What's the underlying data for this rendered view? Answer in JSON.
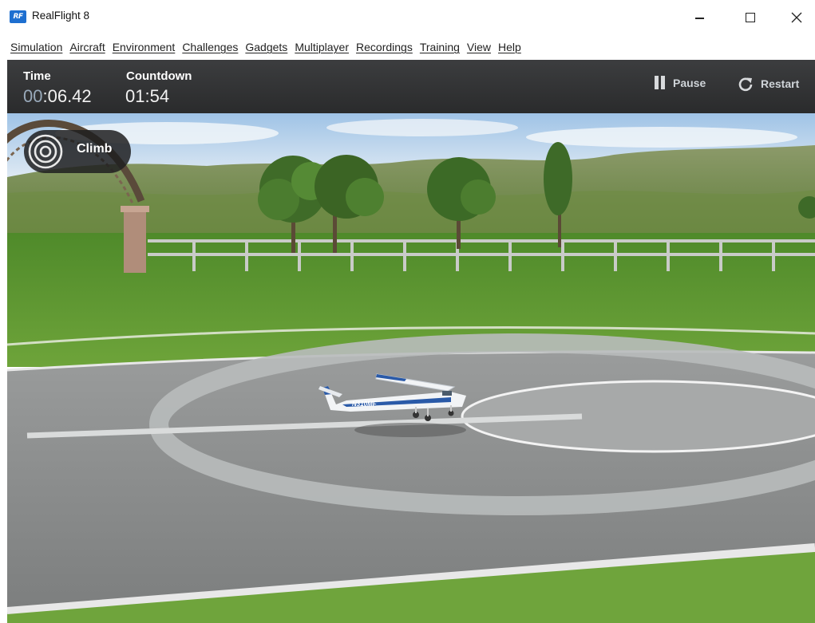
{
  "window": {
    "title": "RealFlight 8",
    "icon_text": "RF"
  },
  "menu": [
    {
      "label": "Simulation"
    },
    {
      "label": "Aircraft"
    },
    {
      "label": "Environment"
    },
    {
      "label": "Challenges"
    },
    {
      "label": "Gadgets"
    },
    {
      "label": "Multiplayer"
    },
    {
      "label": "Recordings"
    },
    {
      "label": "Training"
    },
    {
      "label": "View"
    },
    {
      "label": "Help"
    }
  ],
  "hud": {
    "time_label": "Time",
    "time_prefix": "00",
    "time_rest": ":06.42",
    "countdown_label": "Countdown",
    "countdown_value": "01:54",
    "pause_label": "Pause",
    "restart_label": "Restart"
  },
  "challenge": {
    "name": "Climb",
    "icon": "target-icon"
  },
  "aircraft": {
    "registration": "N310MF"
  },
  "colors": {
    "hud_bg": "#2f3032",
    "sky": "#bcd6ee",
    "grass": "#5e9a30",
    "runway": "#8d8f8f",
    "brand_blue": "#1e6fd0"
  }
}
